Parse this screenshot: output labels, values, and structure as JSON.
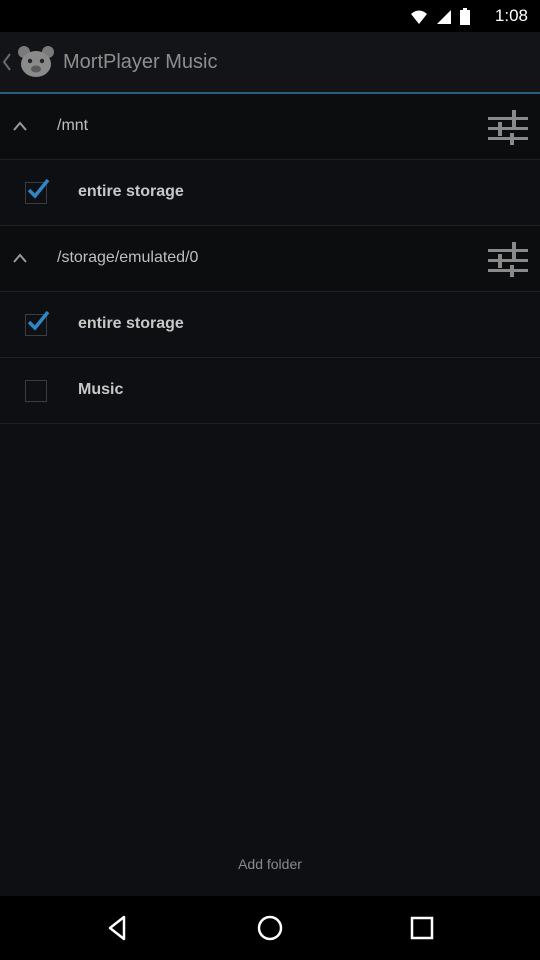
{
  "status_bar": {
    "time": "1:08"
  },
  "app_bar": {
    "title": "MortPlayer Music"
  },
  "sections": [
    {
      "path": "/mnt",
      "items": [
        {
          "label": "entire storage",
          "checked": true
        }
      ]
    },
    {
      "path": "/storage/emulated/0",
      "items": [
        {
          "label": "entire storage",
          "checked": true
        },
        {
          "label": "Music",
          "checked": false
        }
      ]
    }
  ],
  "footer": {
    "add_folder_label": "Add folder"
  },
  "colors": {
    "accent_line": "#2a5e7a",
    "checkmark": "#2f86c9"
  }
}
